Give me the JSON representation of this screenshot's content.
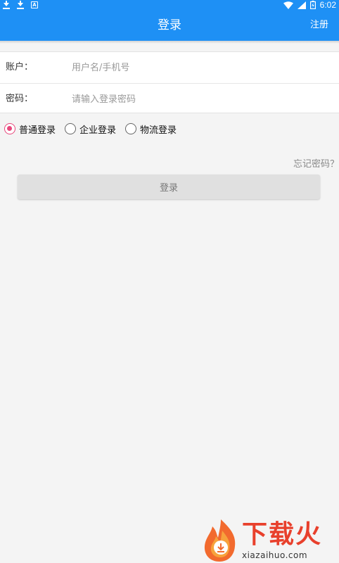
{
  "status_bar": {
    "time": "6:02",
    "icons": [
      "download-icon",
      "download-icon",
      "app-notification-icon",
      "wifi-icon",
      "signal-icon",
      "battery-icon"
    ]
  },
  "app_bar": {
    "title": "登录",
    "register_label": "注册",
    "color": "#1e90f5"
  },
  "form": {
    "account": {
      "label": "账户：",
      "placeholder": "用户名/手机号",
      "value": ""
    },
    "password": {
      "label": "密码：",
      "placeholder": "请输入登录密码",
      "value": ""
    }
  },
  "login_type": {
    "selected": "普通登录",
    "accent_color": "#e8477c",
    "options": [
      {
        "label": "普通登录",
        "checked": true
      },
      {
        "label": "企业登录",
        "checked": false
      },
      {
        "label": "物流登录",
        "checked": false
      }
    ]
  },
  "forgot_password_label": "忘记密码？",
  "login_button_label": "登录",
  "watermark": {
    "logo_text": "下载火",
    "site": "xiazaihuo.com"
  }
}
